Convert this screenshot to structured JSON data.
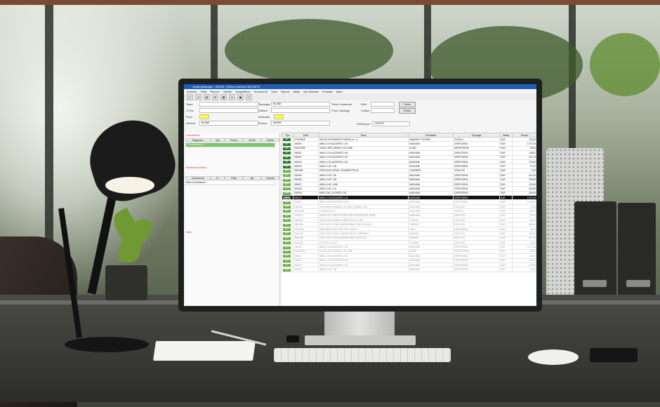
{
  "app": {
    "title": "JewelryManager - ADMIN - [Ricerca Articoli 3501MF2]",
    "menu": [
      "Archivio",
      "Vista",
      "Ricerca",
      "Tabelle",
      "Anagrafiche",
      "Documenti",
      "Tools",
      "Report",
      "Utility",
      "Op.Software",
      "Finestra",
      "Aiuto"
    ],
    "toolbar_icons": [
      "new-icon",
      "open-icon",
      "print-icon",
      "settings-icon",
      "report-icon",
      "link-icon",
      "save-icon",
      "help-icon"
    ]
  },
  "filters": {
    "labels": {
      "testo": "Testo",
      "cod": "C.Fac.",
      "prod": "Prod.",
      "genere": "Genere",
      "tipologia": "Tipologia",
      "settore": "Settore",
      "materiale": "Materiale",
      "prezzo": "Prezzo",
      "titolo_contenuto": "Titolo Contenuto",
      "fuori_catalogo": "Fuori Catalogo",
      "ean": "EAN",
      "codice": "Codice",
      "ordina_per": "Ordina per"
    },
    "values": {
      "tipologia": "BLANK",
      "genere": "BLANK",
      "prezzo": "MINRA",
      "ordina_per": "CODICE"
    },
    "buttons": {
      "cerca": "Cerca",
      "pulisci": "Pulisci"
    },
    "colors": {
      "highlight": "#ffff33"
    }
  },
  "left": {
    "giacenze_title": "Lista Articoli",
    "giacenze_cols": [
      "Magazzino",
      "Qta",
      "Prezzo",
      "ImCM",
      "GiaPar"
    ],
    "giacenze_row": "1 Prenotazioni / I",
    "movimenti_title": "Movimenti Articolo",
    "movimenti_cols": [
      "Documento",
      "N.",
      "Data",
      "qta",
      "Importo"
    ],
    "movimenti_row": "Sede di emissione",
    "note_title": "Note"
  },
  "table": {
    "columns": [
      "Tipo",
      "EAN",
      "Titolo",
      "Produttore",
      "Tipologia",
      "Valuta",
      "Prezzo"
    ],
    "rows": [
      {
        "tag": "INT",
        "ean": "STIORPAP",
        "titolo": "DIR DR R PENDENTE FARFALLA + D",
        "prod": "MAMAM ET SOPHIE",
        "tipo": "GIOIELLI",
        "val": "EUR",
        "prezzo": "100,00",
        "style": "int"
      },
      {
        "tag": "INT",
        "ean": "000000",
        "titolo": "ANELLO FA AZZURRO 1.90",
        "prod": "MAGNANI",
        "tipo": "OREFICERIA",
        "val": "EUR",
        "prezzo": "1.377,50",
        "style": "int"
      },
      {
        "tag": "INT",
        "ean": "000000000",
        "titolo": "CAVIGL ARG SHINNY COL VARI",
        "prod": "ALISEI",
        "tipo": "ARGENTERIA",
        "val": "EUR",
        "prezzo": "65,00",
        "style": "int"
      },
      {
        "tag": "INT",
        "ean": "000001",
        "titolo": "ANELLO FA AZZURRO 2.50",
        "prod": "MAGNANI",
        "tipo": "OREFICERIA",
        "val": "EUR",
        "prezzo": "148,87",
        "style": "int"
      },
      {
        "tag": "INT",
        "ean": "000002",
        "titolo": "ANELLO FA AZZURRO 0.90",
        "prod": "MAGNANI",
        "tipo": "OREFICERIA",
        "val": "EUR",
        "prezzo": "214,76",
        "style": "int"
      },
      {
        "tag": "INT",
        "ean": "000003",
        "titolo": "ANELLO FA AZZURRO 2.60",
        "prod": "MAGNANI",
        "tipo": "OREFICERIA",
        "val": "EUR",
        "prezzo": "279,60",
        "style": "int"
      },
      {
        "tag": "INT",
        "ean": "000004",
        "titolo": "ANELLO 6F 0.36",
        "prod": "MAGNANI",
        "tipo": "OREFICERIA",
        "val": "EUR",
        "prezzo": "47,00",
        "style": "int"
      },
      {
        "tag": "EST",
        "ean": "0000460",
        "titolo": "OROLOGIO UOMO LONGINES PELLE",
        "prod": "LONGINES",
        "tipo": "OROLOGI",
        "val": "EUR",
        "prezzo": "0,00",
        "style": "est"
      },
      {
        "tag": "EST",
        "ean": "000005",
        "titolo": "ANELLO 6F 2.50",
        "prod": "MAGNANI",
        "tipo": "OREFICERIA",
        "val": "EUR",
        "prezzo": "412,81",
        "style": "est"
      },
      {
        "tag": "EST",
        "ean": "000006",
        "titolo": "ANELLO 6F 1.36",
        "prod": "MAGNANI",
        "tipo": "OREFICERIA",
        "val": "EUR",
        "prezzo": "296,59",
        "style": "est"
      },
      {
        "tag": "EST",
        "ean": "000007",
        "titolo": "ANELLO 6F 10.80",
        "prod": "MAGNANI",
        "tipo": "OREFICERIA",
        "val": "EUR",
        "prezzo": "122,00",
        "style": "est"
      },
      {
        "tag": "EST",
        "ean": "000008",
        "titolo": "ANELLO 6F 0.10",
        "prod": "MAGNANI",
        "tipo": "OREFICERIA",
        "val": "EUR",
        "prezzo": "239,80",
        "style": "est"
      },
      {
        "tag": "EST",
        "ean": "000009",
        "titolo": "BRACCIALI 16 NERO 3.00",
        "prod": "MAGNANI",
        "tipo": "OREFICERIA",
        "val": "EUR",
        "prezzo": "400,00",
        "style": "est"
      },
      {
        "tag": "NEW",
        "ean": "000010",
        "titolo": "ANELLO FA AZZURRO 1.30",
        "prod": "MAGNANI",
        "tipo": "OREFICERIA",
        "val": "EUR",
        "prezzo": "1.037,59",
        "style": "sel"
      },
      {
        "tag": "EST",
        "ean": "000011",
        "titolo": "ANELLO FA AZZURRO 25.00",
        "prod": "MAGNANI",
        "tipo": "OREFICERIA",
        "val": "EUR",
        "prezzo": "1.640,00",
        "style": "dim"
      },
      {
        "tag": "EST",
        "ean": "0000111",
        "titolo": "CINTURINO GOMMA COL VARI GOMMA 10.40",
        "prod": "MAGNANI",
        "tipo": "OROLOGI",
        "val": "EUR",
        "prezzo": "10,40",
        "style": "dim"
      },
      {
        "tag": "EST",
        "ean": "00000459",
        "titolo": "CIONDOLO 6 6",
        "prod": "LATTUADA",
        "tipo": "GIOIELLI",
        "val": "EUR",
        "prezzo": "125,00",
        "style": "dim"
      },
      {
        "tag": "EST",
        "ean": "0000472",
        "titolo": "OROLOGIO TASCA FORNITORI VARI MARCHE VARIE",
        "prod": "MAGNANI",
        "tipo": "OROLOGI",
        "val": "EUR",
        "prezzo": "25,00",
        "style": "dim"
      },
      {
        "tag": "EST",
        "ean": "0000160",
        "titolo": "OROLOGIO DONNA LORENZ PELLE ORO",
        "prod": "LORENZ",
        "tipo": "OROLOGI",
        "val": "EUR",
        "prezzo": "740,00",
        "style": "dim"
      },
      {
        "tag": "EST",
        "ean": "0000165",
        "titolo": "OROLOGIO UOMO LORENZ BRACCIALE ACCIAIO",
        "prod": "LORENZ",
        "tipo": "OROLOGI",
        "val": "EUR",
        "prezzo": "685,00",
        "style": "dim"
      },
      {
        "tag": "EST",
        "ean": "00000000",
        "titolo": "MINO SPECCHIO ORO ORO GIALLO",
        "prod": "PARO",
        "tipo": "OREFICERIA",
        "val": "EUR",
        "prezzo": "25,00",
        "style": "dim"
      },
      {
        "tag": "EST",
        "ean": "0000179",
        "titolo": "OROLOGIO UOMO LORENZ PELLE CARBONIO",
        "prod": "LORENZ",
        "tipo": "OROLOGI",
        "val": "EUR",
        "prezzo": "645,00",
        "style": "dim"
      },
      {
        "tag": "EST",
        "ean": "0000185",
        "titolo": "OROLOGIO UOMO ARMANI BRACCIALETTO",
        "prod": "ARMANI",
        "tipo": "OROLOGI",
        "val": "EUR",
        "prezzo": "271,00",
        "style": "dim"
      },
      {
        "tag": "EST",
        "ean": "0000420",
        "titolo": "PILE PILE 12.00 P",
        "prod": "VYZMAN",
        "tipo": "OROLOGI",
        "val": "EUR",
        "prezzo": "12,50",
        "style": "dim"
      },
      {
        "tag": "EST",
        "ean": "000000",
        "titolo": "ANELLO FA AZZURRO 1.90",
        "prod": "MAGNANI",
        "tipo": "OREFICERIA",
        "val": "EUR",
        "prezzo": "1.377,50",
        "style": "dim"
      },
      {
        "tag": "EST",
        "ean": "000000000",
        "titolo": "CAVIGL ARG SHINNY COL VARI",
        "prod": "ALISEI",
        "tipo": "ARGENTERIA",
        "val": "EUR",
        "prezzo": "65,00",
        "style": "dim"
      },
      {
        "tag": "EST",
        "ean": "000001",
        "titolo": "ANELLO FA AZZURRO 2.50",
        "prod": "MAGNANI",
        "tipo": "OREFICERIA",
        "val": "EUR",
        "prezzo": "148,87",
        "style": "dim"
      },
      {
        "tag": "EST",
        "ean": "000002",
        "titolo": "ANELLO FA AZZURRO 0.90",
        "prod": "MAGNANI",
        "tipo": "OREFICERIA",
        "val": "EUR",
        "prezzo": "214,76",
        "style": "dim"
      },
      {
        "tag": "EST",
        "ean": "000003",
        "titolo": "ANELLO FA AZZURRO 2.60",
        "prod": "MAGNANI",
        "tipo": "OREFICERIA",
        "val": "EUR",
        "prezzo": "279,60",
        "style": "dim"
      },
      {
        "tag": "EST",
        "ean": "000004",
        "titolo": "ANELLO 6F 0.36",
        "prod": "MAGNANI",
        "tipo": "OREFICERIA",
        "val": "EUR",
        "prezzo": "47,00",
        "style": "dim"
      }
    ]
  }
}
